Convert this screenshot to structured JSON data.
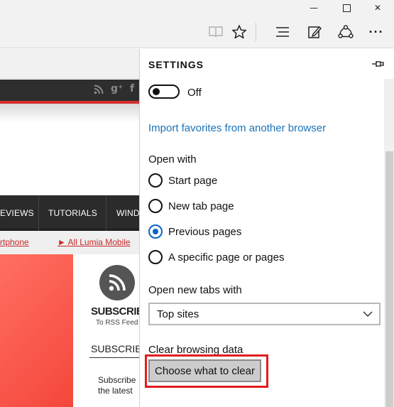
{
  "window": {
    "minimize_glyph": "—",
    "close_glyph": "✕"
  },
  "toolbar": {
    "icons": [
      "reading-view-icon",
      "favorite-star-icon",
      "hub-icon",
      "web-note-icon",
      "share-icon",
      "more-icon"
    ],
    "more_glyph": "···"
  },
  "page": {
    "social_icons": [
      "rss-icon",
      "google-plus-icon",
      "facebook-icon"
    ],
    "nav": [
      "EVIEWS",
      "TUTORIALS",
      "WIND"
    ],
    "links": [
      "rtphone",
      "► All Lumia Mobile"
    ],
    "subscribe_heading": "SUBSCRIB",
    "subscribe_sub": "To RSS Feed",
    "subscribe_heading2": "SUBSCRIB",
    "subscribe_text_line1": "Subscribe",
    "subscribe_text_line2": "the latest"
  },
  "settings": {
    "title": "SETTINGS",
    "toggle": {
      "state": "off",
      "label": "Off"
    },
    "import_link": "Import favorites from another browser",
    "open_with": {
      "label": "Open with",
      "options": [
        "Start page",
        "New tab page",
        "Previous pages",
        "A specific page or pages"
      ],
      "selected": "Previous pages"
    },
    "open_new_tabs": {
      "label": "Open new tabs with",
      "value": "Top sites"
    },
    "clear_browsing": {
      "label": "Clear browsing data",
      "button": "Choose what to clear"
    },
    "colors": {
      "accent": "#0a64c8",
      "link": "#1a73b8",
      "highlight": "#e01e1e"
    }
  }
}
